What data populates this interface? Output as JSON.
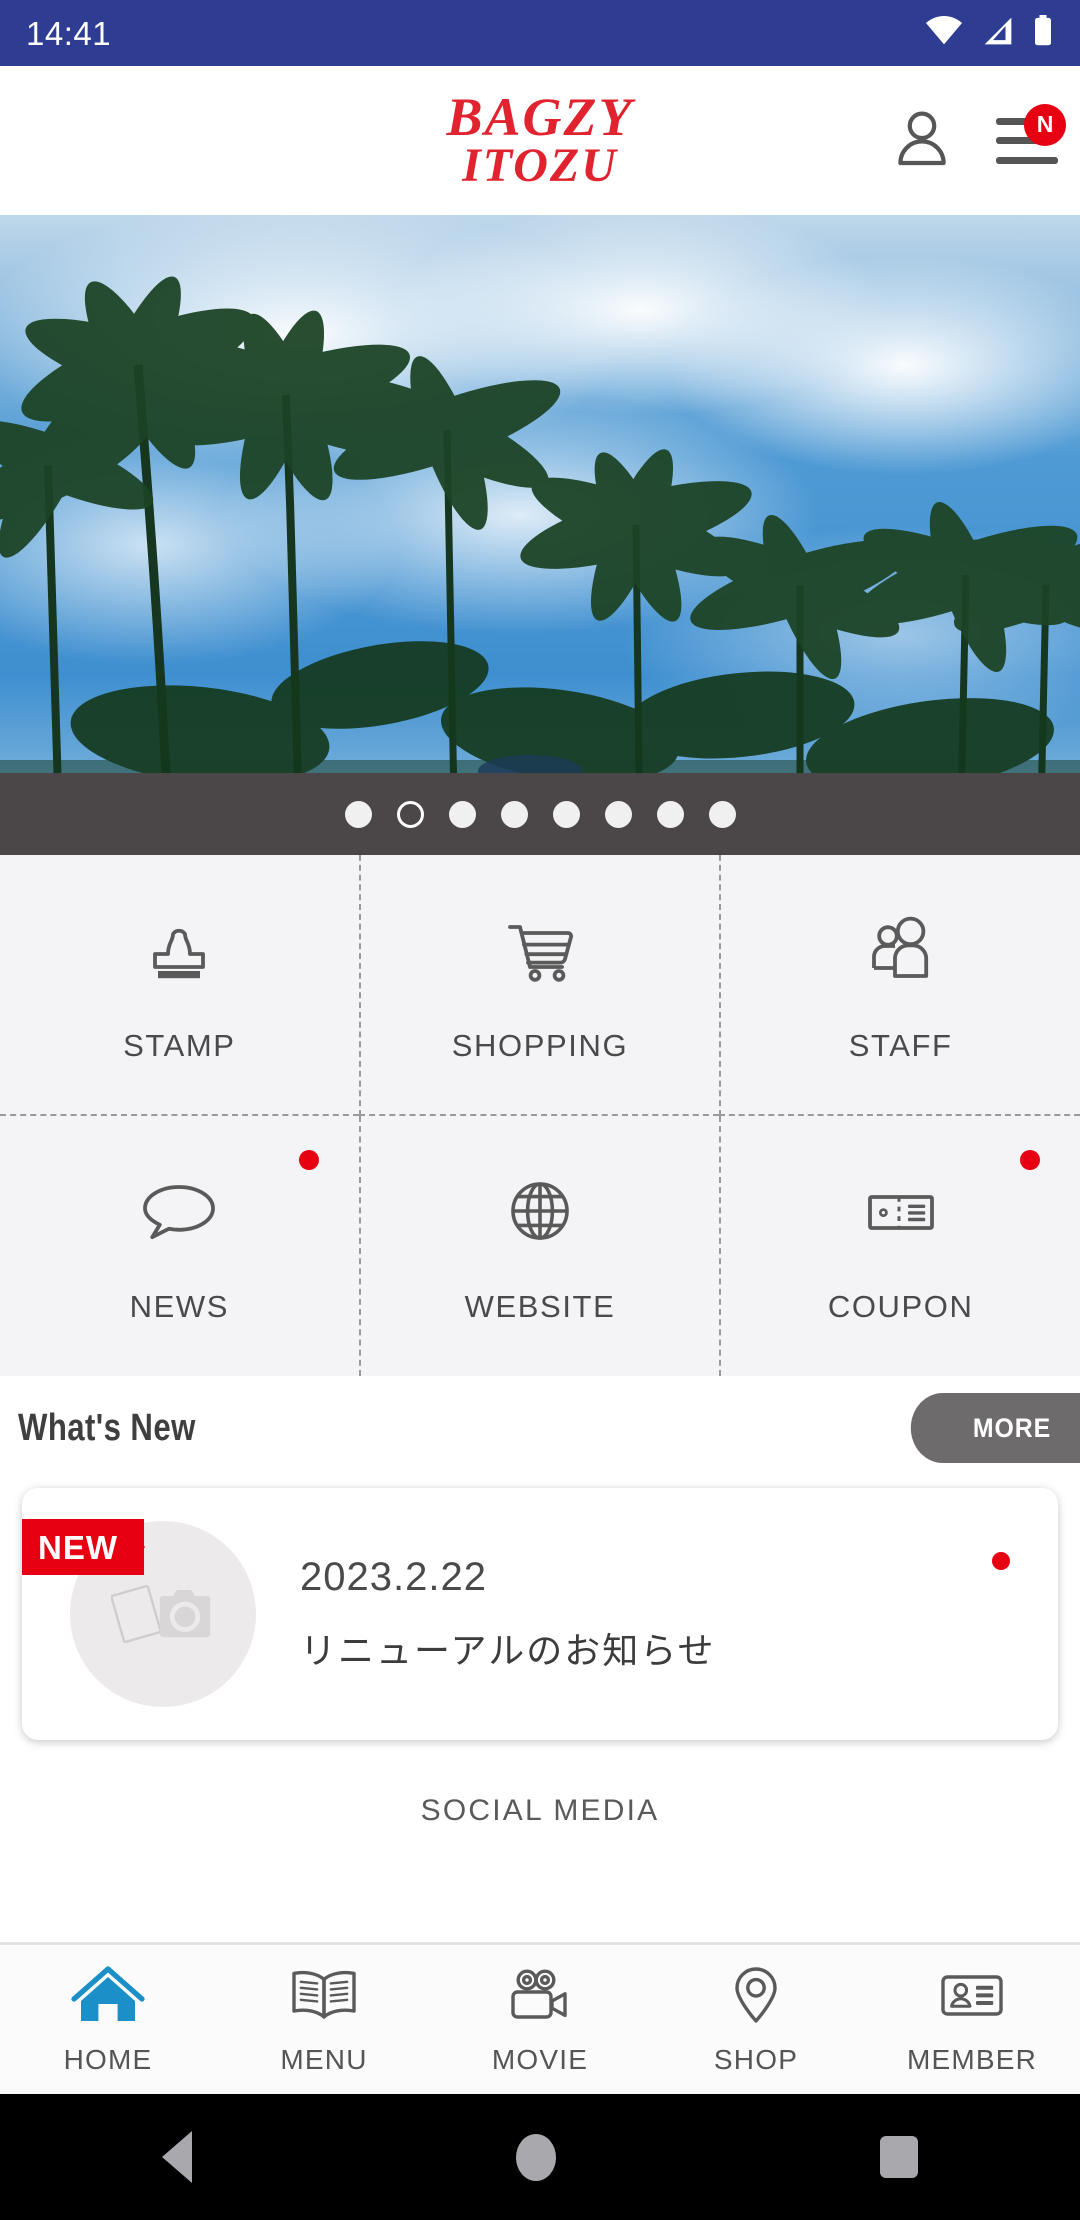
{
  "status_bar": {
    "time": "14:41",
    "icons": [
      "wifi-icon",
      "cellular-signal-icon",
      "battery-icon"
    ],
    "background": "#2e3d92"
  },
  "header": {
    "logo_line1": "BAGZY",
    "logo_line2": "ITOZU",
    "logo_color": "#e0232e",
    "account_icon": "person-icon",
    "menu_icon": "hamburger-menu-icon",
    "menu_badge": "N",
    "badge_color": "#e60012"
  },
  "hero": {
    "alt": "palm trees against blue sky",
    "total_slides": 8,
    "active_slide": 2,
    "dots_background": "#4b4749"
  },
  "menu_grid": {
    "items": [
      {
        "label": "STAMP",
        "icon": "stamp-icon",
        "has_badge": false
      },
      {
        "label": "SHOPPING",
        "icon": "shopping-cart-icon",
        "has_badge": false
      },
      {
        "label": "STAFF",
        "icon": "people-icon",
        "has_badge": false
      },
      {
        "label": "NEWS",
        "icon": "speech-bubble-icon",
        "has_badge": true
      },
      {
        "label": "WEBSITE",
        "icon": "globe-icon",
        "has_badge": false
      },
      {
        "label": "COUPON",
        "icon": "ticket-icon",
        "has_badge": true
      }
    ]
  },
  "whats_new": {
    "title": "What's New",
    "more_label": "MORE",
    "more_background": "#6e6b6c",
    "items": [
      {
        "badge": "NEW",
        "badge_color": "#e60012",
        "date": "2023.2.22",
        "title": "リニューアルのお知らせ",
        "thumbnail_icon": "photo-placeholder-icon",
        "has_dot": true
      }
    ]
  },
  "social_media": {
    "label": "SOCIAL MEDIA"
  },
  "tabbar": {
    "active_color": "#1b8fc7",
    "items": [
      {
        "label": "HOME",
        "icon": "home-icon",
        "active": true
      },
      {
        "label": "MENU",
        "icon": "book-icon",
        "active": false
      },
      {
        "label": "MOVIE",
        "icon": "video-camera-icon",
        "active": false
      },
      {
        "label": "SHOP",
        "icon": "map-pin-icon",
        "active": false
      },
      {
        "label": "MEMBER",
        "icon": "id-card-icon",
        "active": false
      }
    ]
  },
  "system_nav": {
    "back": "back-triangle-icon",
    "home": "home-circle-icon",
    "recents": "recents-square-icon"
  }
}
